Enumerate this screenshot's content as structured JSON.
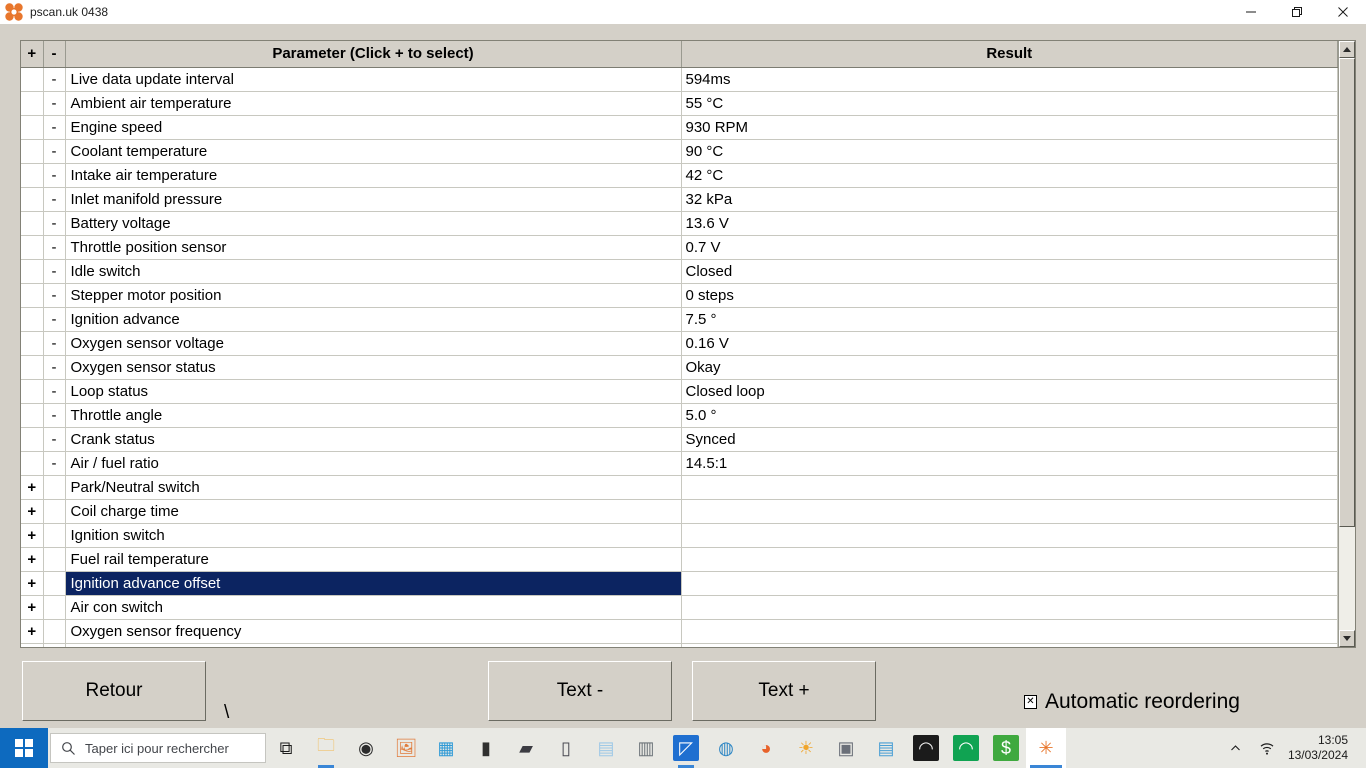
{
  "window": {
    "title": "pscan.uk 0438",
    "icon": "pscan-flower-icon",
    "controls": {
      "minimize": "minimize-icon",
      "restore": "restore-icon",
      "close": "close-icon"
    }
  },
  "table": {
    "headers": {
      "plus": "+",
      "minus": "-",
      "parameter": "Parameter (Click + to select)",
      "result": "Result"
    },
    "rows": [
      {
        "plus": "",
        "minus": "-",
        "parameter": "Live data update interval",
        "result": "594ms",
        "selected": false
      },
      {
        "plus": "",
        "minus": "-",
        "parameter": "Ambient air temperature",
        "result": "55 °C",
        "selected": false
      },
      {
        "plus": "",
        "minus": "-",
        "parameter": "Engine speed",
        "result": "930 RPM",
        "selected": false
      },
      {
        "plus": "",
        "minus": "-",
        "parameter": "Coolant temperature",
        "result": "90 °C",
        "selected": false
      },
      {
        "plus": "",
        "minus": "-",
        "parameter": "Intake air temperature",
        "result": "42 °C",
        "selected": false
      },
      {
        "plus": "",
        "minus": "-",
        "parameter": "Inlet manifold pressure",
        "result": "32 kPa",
        "selected": false
      },
      {
        "plus": "",
        "minus": "-",
        "parameter": "Battery voltage",
        "result": "13.6 V",
        "selected": false
      },
      {
        "plus": "",
        "minus": "-",
        "parameter": "Throttle position sensor",
        "result": "0.7 V",
        "selected": false
      },
      {
        "plus": "",
        "minus": "-",
        "parameter": "Idle switch",
        "result": "Closed",
        "selected": false
      },
      {
        "plus": "",
        "minus": "-",
        "parameter": "Stepper motor position",
        "result": "0 steps",
        "selected": false
      },
      {
        "plus": "",
        "minus": "-",
        "parameter": "Ignition advance",
        "result": "7.5 °",
        "selected": false
      },
      {
        "plus": "",
        "minus": "-",
        "parameter": "Oxygen sensor voltage",
        "result": "0.16 V",
        "selected": false
      },
      {
        "plus": "",
        "minus": "-",
        "parameter": "Oxygen sensor status",
        "result": "Okay",
        "selected": false
      },
      {
        "plus": "",
        "minus": "-",
        "parameter": "Loop status",
        "result": "Closed loop",
        "selected": false
      },
      {
        "plus": "",
        "minus": "-",
        "parameter": "Throttle angle",
        "result": "5.0 °",
        "selected": false
      },
      {
        "plus": "",
        "minus": "-",
        "parameter": "Crank status",
        "result": "Synced",
        "selected": false
      },
      {
        "plus": "",
        "minus": "-",
        "parameter": "Air / fuel ratio",
        "result": "14.5:1",
        "selected": false
      },
      {
        "plus": "+",
        "minus": "",
        "parameter": "Park/Neutral switch",
        "result": "",
        "selected": false
      },
      {
        "plus": "+",
        "minus": "",
        "parameter": "Coil charge time",
        "result": "",
        "selected": false
      },
      {
        "plus": "+",
        "minus": "",
        "parameter": "Ignition switch",
        "result": "",
        "selected": false
      },
      {
        "plus": "+",
        "minus": "",
        "parameter": "Fuel rail temperature",
        "result": "",
        "selected": false
      },
      {
        "plus": "+",
        "minus": "",
        "parameter": "Ignition advance offset",
        "result": "",
        "selected": true
      },
      {
        "plus": "+",
        "minus": "",
        "parameter": "Air con switch",
        "result": "",
        "selected": false
      },
      {
        "plus": "+",
        "minus": "",
        "parameter": "Oxygen sensor frequency",
        "result": "",
        "selected": false
      },
      {
        "plus": "+",
        "minus": "",
        "parameter": "",
        "result": "",
        "selected": false
      }
    ],
    "selection_color": "#0c2461",
    "scrollbar": {
      "up_arrow": "scroll-up-icon",
      "down_arrow": "scroll-down-icon",
      "thumb_fraction": "82%"
    }
  },
  "bottom": {
    "retour": "Retour",
    "backslash": "\\",
    "text_minus": "Text -",
    "text_plus": "Text +",
    "reorder_label": "Automatic reordering",
    "reorder_mark": "✕",
    "reorder_checked": true
  },
  "taskbar": {
    "start": "windows-logo-icon",
    "search_placeholder": "Taper ici pour rechercher",
    "search_icon": "search-icon",
    "icons": [
      {
        "name": "task-view-icon",
        "glyph": "⧉",
        "color": "#1b1b1b",
        "bg": "transparent"
      },
      {
        "name": "file-explorer-icon",
        "glyph": "🗀",
        "color": "#f2b84b",
        "bg": "transparent"
      },
      {
        "name": "camera-app-icon",
        "glyph": "◉",
        "color": "#2b2b2b",
        "bg": "transparent"
      },
      {
        "name": "photos-icon",
        "glyph": "🖼",
        "color": "#e07b3c",
        "bg": "transparent"
      },
      {
        "name": "calendar-icon",
        "glyph": "▦",
        "color": "#2f9ad6",
        "bg": "transparent"
      },
      {
        "name": "handheld-radio-icon",
        "glyph": "▮",
        "color": "#30302f",
        "bg": "transparent"
      },
      {
        "name": "mobile-radio-icon",
        "glyph": "▰",
        "color": "#3c3c42",
        "bg": "transparent"
      },
      {
        "name": "transceiver-icon",
        "glyph": "▯",
        "color": "#4a4a52",
        "bg": "transparent"
      },
      {
        "name": "notepad-icon",
        "glyph": "▤",
        "color": "#9fc9e6",
        "bg": "transparent"
      },
      {
        "name": "calculator-icon",
        "glyph": "▥",
        "color": "#6d7479",
        "bg": "transparent"
      },
      {
        "name": "drawing-app-icon",
        "glyph": "◸",
        "color": "#ffffff",
        "bg": "#1f6fd0"
      },
      {
        "name": "teamviewer-icon",
        "glyph": "◍",
        "color": "#2d86c4",
        "bg": "transparent"
      },
      {
        "name": "firefox-icon",
        "glyph": "◕",
        "color": "#e8622a",
        "bg": "transparent"
      },
      {
        "name": "weather-icon",
        "glyph": "☀",
        "color": "#f0a52b",
        "bg": "transparent"
      },
      {
        "name": "webcam-app-icon",
        "glyph": "▣",
        "color": "#6a6f78",
        "bg": "transparent"
      },
      {
        "name": "contact-card-icon",
        "glyph": "▤",
        "color": "#4a9fd4",
        "bg": "transparent"
      },
      {
        "name": "headphones-app-icon",
        "glyph": "◠",
        "color": "#f0f0f0",
        "bg": "#1b1b1b"
      },
      {
        "name": "audio-tool-icon",
        "glyph": "◠",
        "color": "#ffffff",
        "bg": "#10a352"
      },
      {
        "name": "money-app-icon",
        "glyph": "$",
        "color": "#ffffff",
        "bg": "#3fa93f"
      },
      {
        "name": "pscan-app-icon",
        "glyph": "✳",
        "color": "#e8762c",
        "bg": "#ffffff"
      }
    ],
    "tray": {
      "chevron": "show-hidden-icons-icon",
      "network": "wifi-icon",
      "time": "13:05",
      "date": "13/03/2024"
    }
  }
}
